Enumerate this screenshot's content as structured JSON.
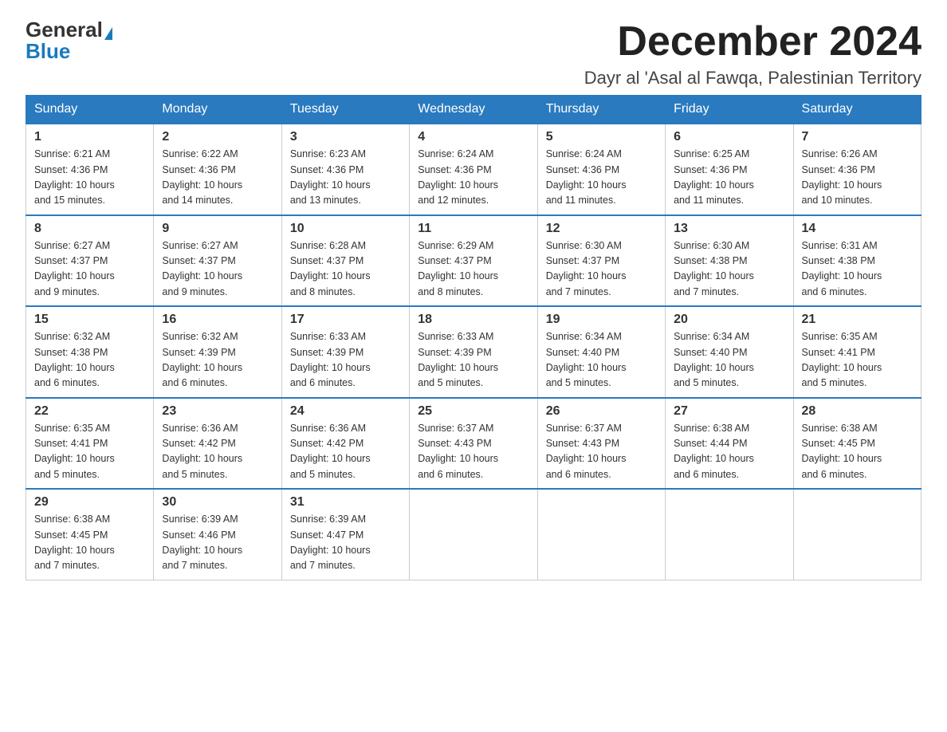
{
  "logo": {
    "general": "General",
    "blue": "Blue"
  },
  "header": {
    "month_title": "December 2024",
    "location": "Dayr al 'Asal al Fawqa, Palestinian Territory"
  },
  "days_of_week": [
    "Sunday",
    "Monday",
    "Tuesday",
    "Wednesday",
    "Thursday",
    "Friday",
    "Saturday"
  ],
  "weeks": [
    [
      {
        "day": "1",
        "sunrise": "6:21 AM",
        "sunset": "4:36 PM",
        "daylight": "10 hours and 15 minutes."
      },
      {
        "day": "2",
        "sunrise": "6:22 AM",
        "sunset": "4:36 PM",
        "daylight": "10 hours and 14 minutes."
      },
      {
        "day": "3",
        "sunrise": "6:23 AM",
        "sunset": "4:36 PM",
        "daylight": "10 hours and 13 minutes."
      },
      {
        "day": "4",
        "sunrise": "6:24 AM",
        "sunset": "4:36 PM",
        "daylight": "10 hours and 12 minutes."
      },
      {
        "day": "5",
        "sunrise": "6:24 AM",
        "sunset": "4:36 PM",
        "daylight": "10 hours and 11 minutes."
      },
      {
        "day": "6",
        "sunrise": "6:25 AM",
        "sunset": "4:36 PM",
        "daylight": "10 hours and 11 minutes."
      },
      {
        "day": "7",
        "sunrise": "6:26 AM",
        "sunset": "4:36 PM",
        "daylight": "10 hours and 10 minutes."
      }
    ],
    [
      {
        "day": "8",
        "sunrise": "6:27 AM",
        "sunset": "4:37 PM",
        "daylight": "10 hours and 9 minutes."
      },
      {
        "day": "9",
        "sunrise": "6:27 AM",
        "sunset": "4:37 PM",
        "daylight": "10 hours and 9 minutes."
      },
      {
        "day": "10",
        "sunrise": "6:28 AM",
        "sunset": "4:37 PM",
        "daylight": "10 hours and 8 minutes."
      },
      {
        "day": "11",
        "sunrise": "6:29 AM",
        "sunset": "4:37 PM",
        "daylight": "10 hours and 8 minutes."
      },
      {
        "day": "12",
        "sunrise": "6:30 AM",
        "sunset": "4:37 PM",
        "daylight": "10 hours and 7 minutes."
      },
      {
        "day": "13",
        "sunrise": "6:30 AM",
        "sunset": "4:38 PM",
        "daylight": "10 hours and 7 minutes."
      },
      {
        "day": "14",
        "sunrise": "6:31 AM",
        "sunset": "4:38 PM",
        "daylight": "10 hours and 6 minutes."
      }
    ],
    [
      {
        "day": "15",
        "sunrise": "6:32 AM",
        "sunset": "4:38 PM",
        "daylight": "10 hours and 6 minutes."
      },
      {
        "day": "16",
        "sunrise": "6:32 AM",
        "sunset": "4:39 PM",
        "daylight": "10 hours and 6 minutes."
      },
      {
        "day": "17",
        "sunrise": "6:33 AM",
        "sunset": "4:39 PM",
        "daylight": "10 hours and 6 minutes."
      },
      {
        "day": "18",
        "sunrise": "6:33 AM",
        "sunset": "4:39 PM",
        "daylight": "10 hours and 5 minutes."
      },
      {
        "day": "19",
        "sunrise": "6:34 AM",
        "sunset": "4:40 PM",
        "daylight": "10 hours and 5 minutes."
      },
      {
        "day": "20",
        "sunrise": "6:34 AM",
        "sunset": "4:40 PM",
        "daylight": "10 hours and 5 minutes."
      },
      {
        "day": "21",
        "sunrise": "6:35 AM",
        "sunset": "4:41 PM",
        "daylight": "10 hours and 5 minutes."
      }
    ],
    [
      {
        "day": "22",
        "sunrise": "6:35 AM",
        "sunset": "4:41 PM",
        "daylight": "10 hours and 5 minutes."
      },
      {
        "day": "23",
        "sunrise": "6:36 AM",
        "sunset": "4:42 PM",
        "daylight": "10 hours and 5 minutes."
      },
      {
        "day": "24",
        "sunrise": "6:36 AM",
        "sunset": "4:42 PM",
        "daylight": "10 hours and 5 minutes."
      },
      {
        "day": "25",
        "sunrise": "6:37 AM",
        "sunset": "4:43 PM",
        "daylight": "10 hours and 6 minutes."
      },
      {
        "day": "26",
        "sunrise": "6:37 AM",
        "sunset": "4:43 PM",
        "daylight": "10 hours and 6 minutes."
      },
      {
        "day": "27",
        "sunrise": "6:38 AM",
        "sunset": "4:44 PM",
        "daylight": "10 hours and 6 minutes."
      },
      {
        "day": "28",
        "sunrise": "6:38 AM",
        "sunset": "4:45 PM",
        "daylight": "10 hours and 6 minutes."
      }
    ],
    [
      {
        "day": "29",
        "sunrise": "6:38 AM",
        "sunset": "4:45 PM",
        "daylight": "10 hours and 7 minutes."
      },
      {
        "day": "30",
        "sunrise": "6:39 AM",
        "sunset": "4:46 PM",
        "daylight": "10 hours and 7 minutes."
      },
      {
        "day": "31",
        "sunrise": "6:39 AM",
        "sunset": "4:47 PM",
        "daylight": "10 hours and 7 minutes."
      },
      null,
      null,
      null,
      null
    ]
  ],
  "labels": {
    "sunrise": "Sunrise:",
    "sunset": "Sunset:",
    "daylight": "Daylight:"
  }
}
